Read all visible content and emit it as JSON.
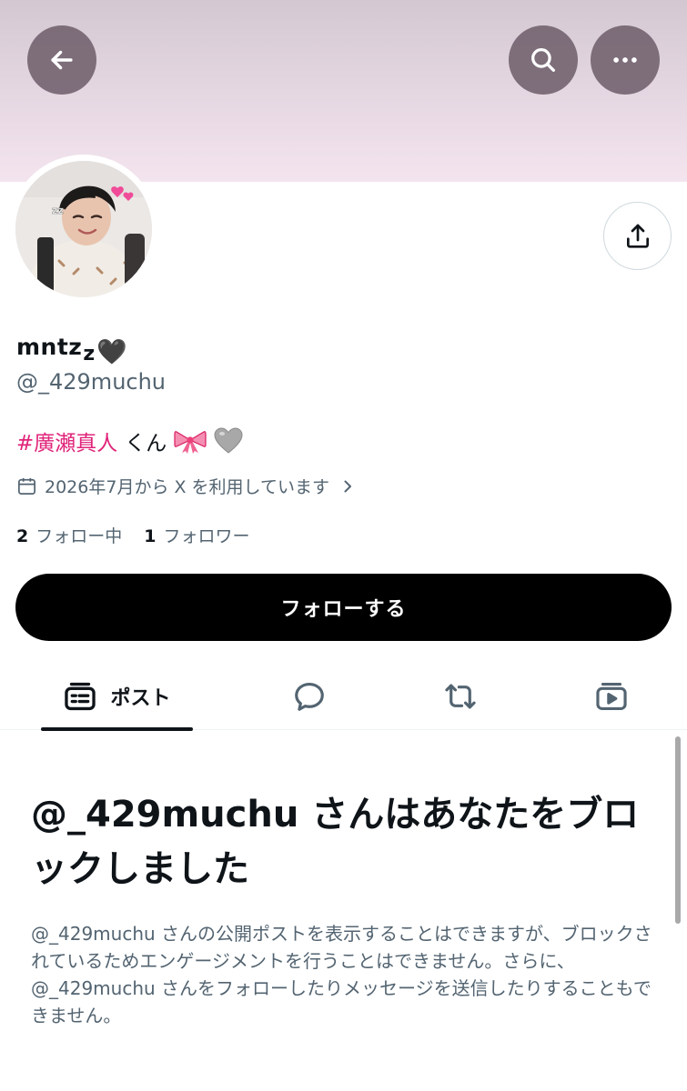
{
  "header": {
    "back_icon": "arrow-left-icon",
    "search_icon": "search-icon",
    "more_icon": "more-horizontal-icon",
    "banner_color": "#efe0ea"
  },
  "profile": {
    "avatar_icon": "profile-photo",
    "share_icon": "share-icon",
    "display_name": "mntz",
    "display_name_suffix": "z",
    "display_name_emoji": "🖤",
    "handle": "@_429muchu",
    "bio": {
      "hashtag": "#廣瀬真人",
      "text": "くん",
      "emojis": [
        "ribbon-emoji",
        "grey-heart-emoji"
      ]
    },
    "joined": "2026年7月から X を利用しています",
    "following_count": "2",
    "following_label": "フォロー中",
    "followers_count": "1",
    "followers_label": "フォロワー",
    "follow_button": "フォローする"
  },
  "tabs": [
    {
      "label": "ポスト",
      "icon": "posts-icon",
      "active": true
    },
    {
      "label": "",
      "icon": "replies-icon",
      "active": false
    },
    {
      "label": "",
      "icon": "repost-icon",
      "active": false
    },
    {
      "label": "",
      "icon": "media-icon",
      "active": false
    }
  ],
  "blocked": {
    "title": "@_429muchu さんはあなたをブロックしました",
    "description": "@_429muchu さんの公開ポストを表示することはできますが、ブロックされているためエンゲージメントを行うことはできません。さらに、@_429muchu さんをフォローしたりメッセージを送信したりすることもできません。"
  },
  "colors": {
    "accent_hashtag": "#e0247a",
    "secondary_text": "#536471",
    "primary_text": "#0f1419"
  }
}
